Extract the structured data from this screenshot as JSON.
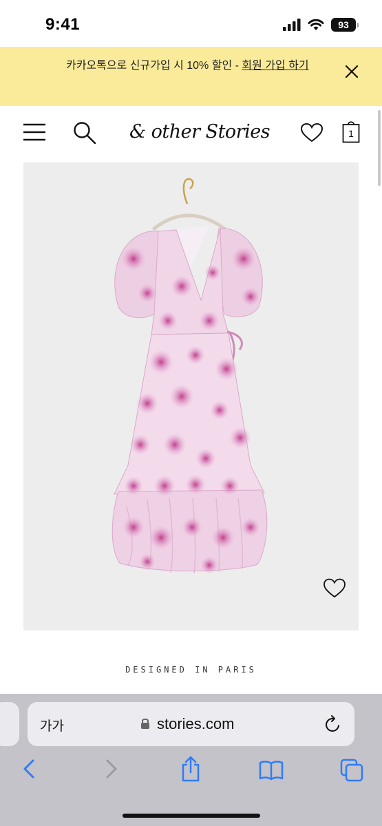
{
  "status_bar": {
    "time": "9:41",
    "battery": "93",
    "icons": [
      "signal-icon",
      "wifi-icon",
      "battery-icon"
    ]
  },
  "promo": {
    "text_main": "카카오톡으로 신규가입 시 10% 할인 - ",
    "text_link": "회원 가입 하기",
    "background": "#faeb9a",
    "close_icon": "close-icon"
  },
  "header": {
    "logo": "& other Stories",
    "cart_count": "1",
    "icons": [
      "menu-icon",
      "search-icon",
      "heart-icon",
      "bag-icon"
    ]
  },
  "product": {
    "image_description": "pink floral wrap midi dress on hanger",
    "wishlist_icon": "heart-icon"
  },
  "tagline": "DESIGNED IN PARIS",
  "browser": {
    "aa_label": "가가",
    "url": "stories.com",
    "toolbar_icons": [
      "back-icon",
      "forward-icon",
      "share-icon",
      "bookmarks-icon",
      "tabs-icon"
    ],
    "accent": "#2f7cf6"
  }
}
